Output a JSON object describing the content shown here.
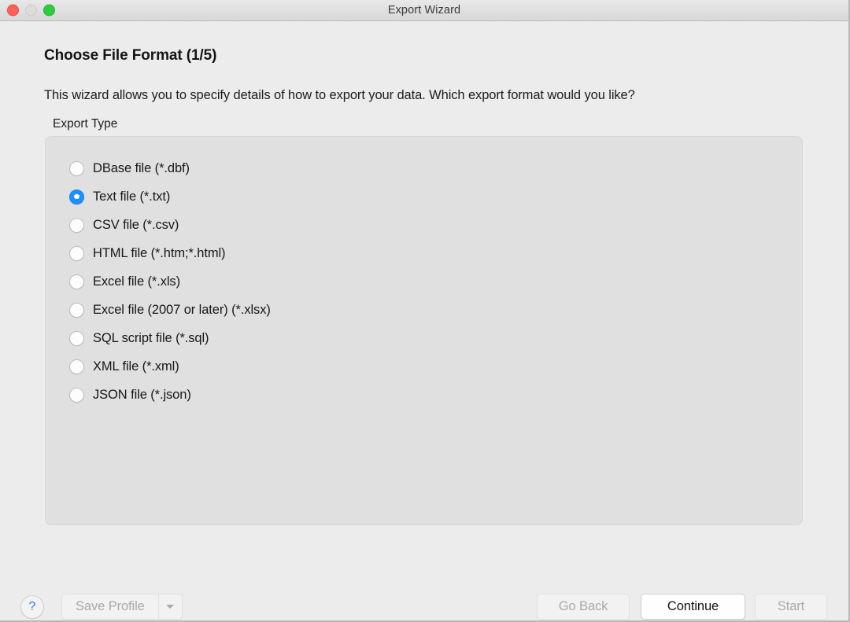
{
  "window": {
    "title": "Export Wizard",
    "traffic_lights": [
      {
        "name": "close",
        "color": "#ff6159",
        "enabled": true
      },
      {
        "name": "minimize",
        "color": "#dcdcdc",
        "enabled": false
      },
      {
        "name": "maximize",
        "color": "#2fcc41",
        "enabled": true
      }
    ]
  },
  "page": {
    "title": "Choose File Format (1/5)",
    "description": "This wizard allows you to specify details of how to export your data. Which export format would you like?",
    "step": 1,
    "total_steps": 5
  },
  "export_type": {
    "group_label": "Export Type",
    "selected_index": 1,
    "options": [
      {
        "label": "DBase file (*.dbf)",
        "selected": false
      },
      {
        "label": "Text file (*.txt)",
        "selected": true
      },
      {
        "label": "CSV file (*.csv)",
        "selected": false
      },
      {
        "label": "HTML file (*.htm;*.html)",
        "selected": false
      },
      {
        "label": "Excel file (*.xls)",
        "selected": false
      },
      {
        "label": "Excel file (2007 or later) (*.xlsx)",
        "selected": false
      },
      {
        "label": "SQL script file (*.sql)",
        "selected": false
      },
      {
        "label": "XML file (*.xml)",
        "selected": false
      },
      {
        "label": "JSON file (*.json)",
        "selected": false
      }
    ]
  },
  "footer": {
    "help_label": "?",
    "save_profile_label": "Save Profile",
    "save_profile_enabled": false,
    "go_back_label": "Go Back",
    "go_back_enabled": false,
    "continue_label": "Continue",
    "continue_enabled": true,
    "start_label": "Start",
    "start_enabled": false
  },
  "colors": {
    "accent": "#1e8fff",
    "help_glyph": "#2b7dfb",
    "window_bg": "#ececec",
    "group_bg": "#e0e0e0"
  }
}
